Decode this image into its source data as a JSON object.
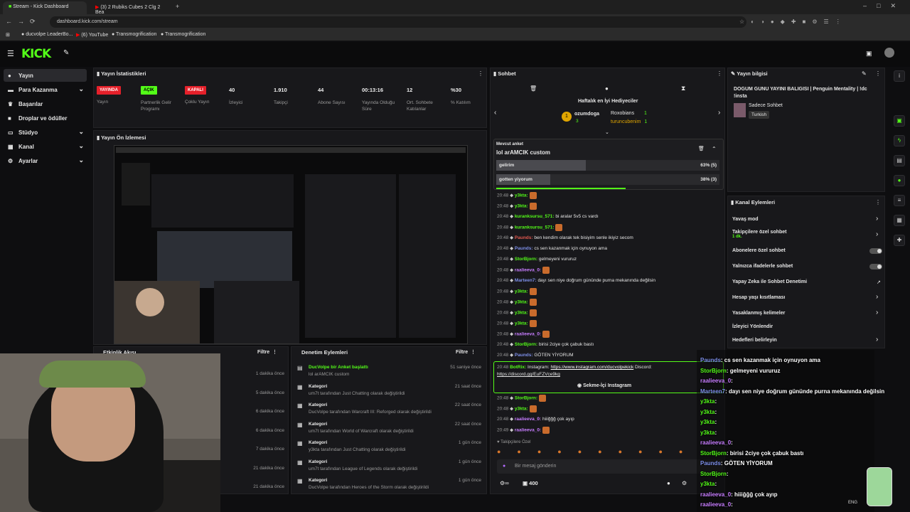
{
  "browser": {
    "tab1": "Stream - Kick Dashboard",
    "tab2": "(3) 2 Rubiks Cubes 2 Clg 2 Bea",
    "url": "dashboard.kick.com/stream",
    "bookmarks": [
      "ducvolpe LeaderBo...",
      "(6) YouTube",
      "Transmogrification",
      "Transmogrification"
    ]
  },
  "sidebar": {
    "items": [
      {
        "label": "Yayın",
        "icon": "broadcast-icon"
      },
      {
        "label": "Para Kazanma",
        "icon": "money-icon"
      },
      {
        "label": "Başarılar",
        "icon": "trophy-icon"
      },
      {
        "label": "Droplar ve ödüller",
        "icon": "gift-icon"
      },
      {
        "label": "Stüdyo",
        "icon": "studio-icon"
      },
      {
        "label": "Kanal",
        "icon": "channel-icon"
      },
      {
        "label": "Ayarlar",
        "icon": "gear-icon"
      }
    ]
  },
  "stats": {
    "title": "Yayın İstatistikleri",
    "badges": {
      "live": "YAYINDA",
      "open": "AÇIK",
      "closed": "KAPALI"
    },
    "labels": {
      "live": "Yayın",
      "partner": "Partnerlik Gelir Programı",
      "multi": "Çoklu Yayın"
    },
    "items": [
      {
        "value": "40",
        "label": "İzleyici"
      },
      {
        "value": "1.910",
        "label": "Takipçi"
      },
      {
        "value": "44",
        "label": "Abone Sayısı"
      },
      {
        "value": "00:13:16",
        "label": "Yayında Olduğu Süre"
      },
      {
        "value": "12",
        "label": "Ort. Sohbete Katılanlar"
      },
      {
        "value": "%30",
        "label": "% Katılım"
      }
    ]
  },
  "preview": {
    "title": "Yayın Ön İzlemesi"
  },
  "activity": {
    "title": "Etkinlik Akışı",
    "filter": "Filtre",
    "times": [
      "1 dakika önce",
      "5 dakika önce",
      "6 dakika önce",
      "6 dakika önce",
      "7 dakika önce",
      "21 dakika önce",
      "21 dakika önce"
    ]
  },
  "mod": {
    "title": "Denetim Eylemleri",
    "filter": "Filtre",
    "items": [
      {
        "head": "DucVolpe bir Anket başlattı",
        "sub": "lol arAMCIK custom",
        "time": "51 saniye önce"
      },
      {
        "head": "Kategori",
        "sub": "um7t tarafından Just Chatting olarak değiştirildi",
        "time": "21 saat önce"
      },
      {
        "head": "Kategori",
        "sub": "DucVolpe tarafından Warcraft III: Reforged olarak değiştirildi",
        "time": "22 saat önce"
      },
      {
        "head": "Kategori",
        "sub": "um7t tarafından World of Warcraft olarak değiştirildi",
        "time": "22 saat önce"
      },
      {
        "head": "Kategori",
        "sub": "y3kta tarafından Just Chatting olarak değiştirildi",
        "time": "1 gün önce"
      },
      {
        "head": "Kategori",
        "sub": "um7t tarafından League of Legends olarak değiştirildi",
        "time": "1 gün önce"
      },
      {
        "head": "Kategori",
        "sub": "DucVolpe tarafından Heroes of the Storm olarak değiştirildi",
        "time": "1 gün önce"
      }
    ]
  },
  "chat": {
    "title": "Sohbet",
    "gifters_title": "Haftalık en İyi Hediyeciler",
    "gifters": [
      {
        "name": "ozumdoga",
        "count": "3"
      },
      {
        "name": "Roxobians",
        "count": "1"
      },
      {
        "name": "turuncubenim",
        "count": "1"
      }
    ],
    "poll": {
      "label": "Mevcut anket",
      "question": "lol arAMCIK custom",
      "options": [
        {
          "text": "gelirim",
          "result": "63% (5)",
          "pct": 63
        },
        {
          "text": "gotten yiyorum",
          "result": "38% (3)",
          "pct": 38
        }
      ]
    },
    "lines": [
      {
        "t": "20:48",
        "u": "y3kta:",
        "c": "#53fc18",
        "m": ""
      },
      {
        "t": "20:48",
        "u": "y3kta:",
        "c": "#53fc18",
        "m": ""
      },
      {
        "t": "20:48",
        "u": "kuranksursu_571:",
        "c": "#53fc18",
        "m": "bi aralar 5v5 cs vardı"
      },
      {
        "t": "20:48",
        "u": "kuranksursu_571:",
        "c": "#53fc18",
        "m": ""
      },
      {
        "t": "20:48",
        "u": "Paunds:",
        "c": "#e0584e",
        "m": "ben kendim olarak tek bisiyim senle ikiyiz secom"
      },
      {
        "t": "20:48",
        "u": "Paunds:",
        "c": "#7d8fe8",
        "m": "cs sen kazanmak için oynuyon ama"
      },
      {
        "t": "20:48",
        "u": "StorBjorn:",
        "c": "#53fc18",
        "m": "gelmeyeni vururuz"
      },
      {
        "t": "20:48",
        "u": "raalieeva_0:",
        "c": "#c77dff",
        "m": ""
      },
      {
        "t": "20:48",
        "u": "Marteen7:",
        "c": "#7d8fe8",
        "m": "dayı sen niye doğrum gününde purna mekanında değilsin"
      },
      {
        "t": "20:48",
        "u": "y3kta:",
        "c": "#53fc18",
        "m": ""
      },
      {
        "t": "20:48",
        "u": "y3kta:",
        "c": "#53fc18",
        "m": ""
      },
      {
        "t": "20:48",
        "u": "y3kta:",
        "c": "#53fc18",
        "m": ""
      },
      {
        "t": "20:48",
        "u": "y3kta:",
        "c": "#53fc18",
        "m": ""
      },
      {
        "t": "20:48",
        "u": "raalieeva_0:",
        "c": "#c77dff",
        "m": ""
      },
      {
        "t": "20:48",
        "u": "StorBjorn:",
        "c": "#53fc18",
        "m": "birisi 2ciye çok çabuk bastı"
      },
      {
        "t": "20:48",
        "u": "Paunds:",
        "c": "#7d8fe8",
        "m": "GÖTEN YİYORUM"
      }
    ],
    "bot": {
      "time": "20:48",
      "user": "BotRix:",
      "msg": "Instagram:",
      "link1": "https://www.instagram.com/ducvolpekick",
      "mid": "Discord:",
      "link2": "https://discord.gg/EuFZVce9kg",
      "button": "Sekme-İçi Instagram"
    },
    "lines2": [
      {
        "t": "20:48",
        "u": "StorBjorn:",
        "c": "#53fc18",
        "m": ""
      },
      {
        "t": "20:48",
        "u": "y3kta:",
        "c": "#53fc18",
        "m": ""
      },
      {
        "t": "20:48",
        "u": "raalieeva_0:",
        "c": "#c77dff",
        "m": "hiiiğğğ çok ayıp"
      },
      {
        "t": "20:49",
        "u": "raalieeva_0:",
        "c": "#c77dff",
        "m": ""
      }
    ],
    "followers_label": "Takipçilere Özel",
    "input_placeholder": "Bir mesaj gönderin",
    "count": "400"
  },
  "info": {
    "title": "Yayın bilgisi",
    "stream_title": "DOGUM GUNU YAYINI BALIGISI | Penguin Mentality | !dc !insta",
    "chat_only": "Sadece Sohbet",
    "lang": "Turkish"
  },
  "actions": {
    "title": "Kanal Eylemleri",
    "items": [
      {
        "label": "Yavaş mod",
        "type": "chevron"
      },
      {
        "label": "Takipçilere özel sohbet",
        "sub": "1 dk.",
        "type": "chevron"
      },
      {
        "label": "Abonelere özel sohbet",
        "type": "toggle"
      },
      {
        "label": "Yalnızca ifadelerle sohbet",
        "type": "toggle"
      },
      {
        "label": "Yapay Zeka ile Sohbet Denetimi",
        "type": "ext"
      },
      {
        "label": "Hesap yaşı kısıtlaması",
        "type": "chevron"
      },
      {
        "label": "Yasaklanmış kelimeler",
        "type": "chevron"
      },
      {
        "label": "İzleyici Yönlendir",
        "type": "none"
      },
      {
        "label": "Hedefleri belirleyin",
        "type": "chevron"
      }
    ]
  },
  "overlay": {
    "lines": [
      {
        "u": "Paunds",
        "c": "#7d8fe8",
        "m": ": cs sen kazanmak için oynuyon ama"
      },
      {
        "u": "StorBjorn",
        "c": "#53fc18",
        "m": ": gelmeyeni vururuz"
      },
      {
        "u": "raalieeva_0",
        "c": "#c77dff",
        "m": ": "
      },
      {
        "u": "Marteen7",
        "c": "#7d8fe8",
        "m": ": dayı sen niye doğrum gününde purna mekanında değilsin"
      },
      {
        "u": "y3kta",
        "c": "#53fc18",
        "m": ": "
      },
      {
        "u": "y3kta",
        "c": "#53fc18",
        "m": ": "
      },
      {
        "u": "y3kta",
        "c": "#53fc18",
        "m": ": "
      },
      {
        "u": "y3kta",
        "c": "#53fc18",
        "m": ": "
      },
      {
        "u": "raalieeva_0",
        "c": "#c77dff",
        "m": ": "
      },
      {
        "u": "StorBjorn",
        "c": "#53fc18",
        "m": ": birisi 2ciye çok çabuk bastı"
      },
      {
        "u": "Paunds",
        "c": "#7d8fe8",
        "m": ": GÖTEN YİYORUM"
      },
      {
        "u": "StorBjorn",
        "c": "#53fc18",
        "m": ": "
      },
      {
        "u": "y3kta",
        "c": "#53fc18",
        "m": ": "
      },
      {
        "u": "raalieeva_0",
        "c": "#c77dff",
        "m": ": hiiiğğğ çok ayıp"
      },
      {
        "u": "raalieeva_0",
        "c": "#c77dff",
        "m": ": "
      }
    ]
  },
  "taskbar": {
    "lang": "ENG"
  }
}
